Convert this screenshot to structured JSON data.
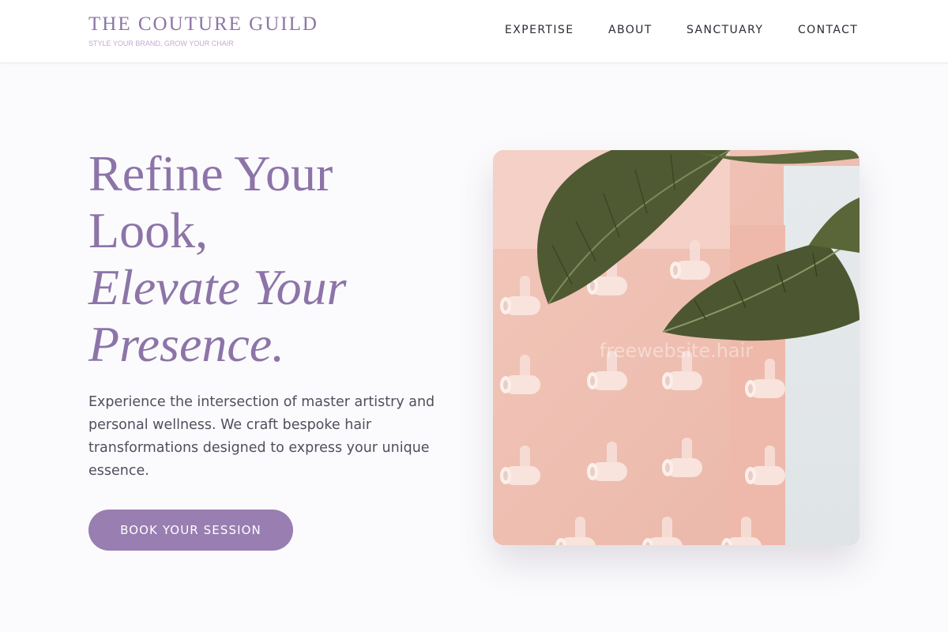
{
  "brand": {
    "name": "THE COUTURE GUILD",
    "tagline": "STYLE YOUR BRAND, GROW YOUR CHAIR"
  },
  "nav": {
    "items": [
      {
        "label": "EXPERTISE"
      },
      {
        "label": "ABOUT"
      },
      {
        "label": "SANCTUARY"
      },
      {
        "label": "CONTACT"
      }
    ]
  },
  "hero": {
    "title_line1": "Refine Your",
    "title_line2": "Look,",
    "title_line3": "Elevate Your",
    "title_line4": "Presence.",
    "description": "Experience the intersection of master artistry and personal wellness. We craft bespoke hair transformations designed to express your unique essence.",
    "cta_label": "BOOK YOUR SESSION",
    "image_watermark": "freewebsite.hair"
  },
  "colors": {
    "accent": "#987eb1",
    "title": "#8d74a8",
    "tagline": "#c8a7d3",
    "background": "#fbfbfd"
  }
}
